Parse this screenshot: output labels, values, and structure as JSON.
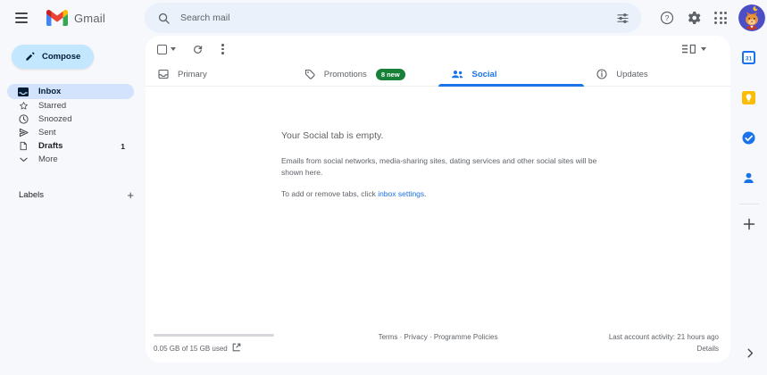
{
  "colors": {
    "accent_blue": "#1a73e8",
    "badge_green": "#188038",
    "compose_bg": "#c2e7ff",
    "selected_item_bg": "#d3e3fd",
    "surface": "#f6f8fc",
    "card_bg": "#ffffff",
    "text_secondary": "#5f6368"
  },
  "header": {
    "product_name": "Gmail",
    "search_placeholder": "Search mail",
    "help_glyph": "?"
  },
  "sidebar": {
    "compose_label": "Compose",
    "items": [
      {
        "label": "Inbox"
      },
      {
        "label": "Starred"
      },
      {
        "label": "Snoozed"
      },
      {
        "label": "Sent"
      },
      {
        "label": "Drafts",
        "count": "1"
      },
      {
        "label": "More"
      }
    ],
    "labels_header": "Labels"
  },
  "tabs": [
    {
      "label": "Primary"
    },
    {
      "label": "Promotions",
      "badge": "8 new"
    },
    {
      "label": "Social"
    },
    {
      "label": "Updates"
    }
  ],
  "empty_state": {
    "title": "Your Social tab is empty.",
    "description": "Emails from social networks, media-sharing sites, dating services and other social sites will be shown here.",
    "settings_prefix": "To add or remove tabs, click ",
    "settings_link": "inbox settings",
    "settings_suffix": "."
  },
  "footer": {
    "storage": "0.05 GB of 15 GB used",
    "links": [
      "Terms",
      "Privacy",
      "Programme Policies"
    ],
    "separator": "·",
    "last_activity": "Last account activity: 21 hours ago",
    "details": "Details"
  },
  "right_panel": {
    "calendar_day": "31"
  }
}
